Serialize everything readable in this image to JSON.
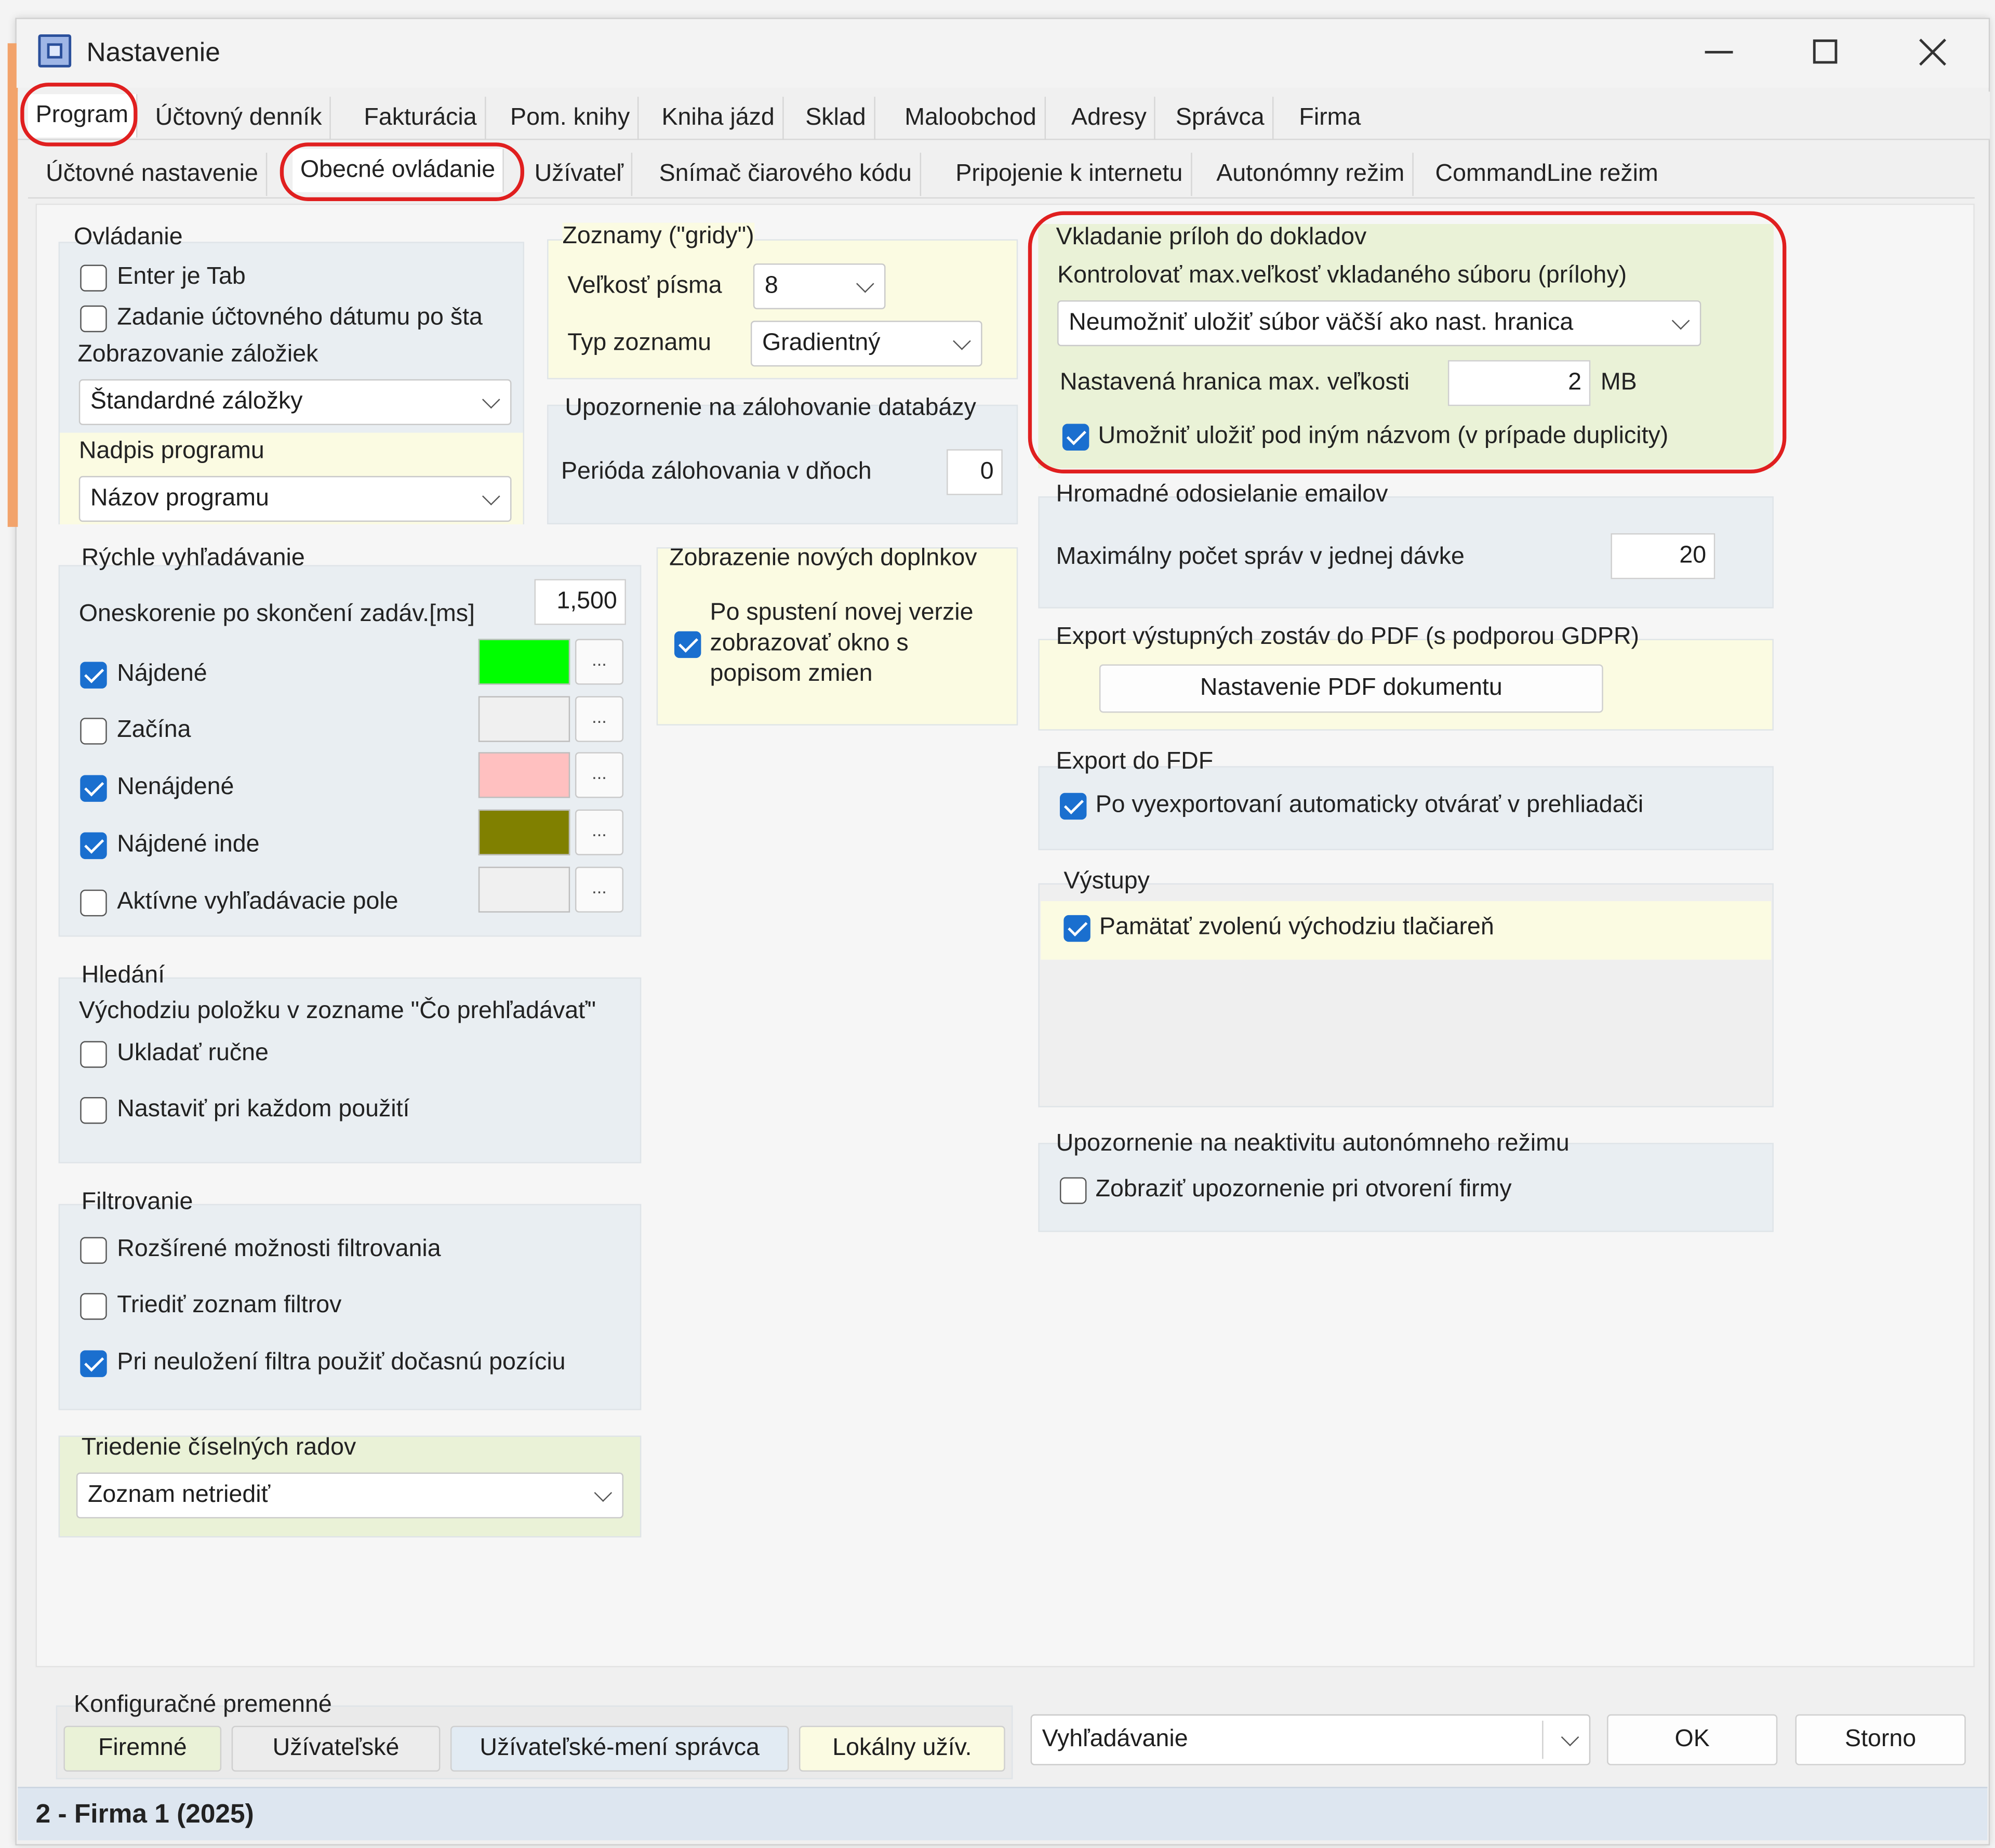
{
  "window": {
    "title": "Nastavenie"
  },
  "main_tabs": [
    "Program",
    "Účtovný denník",
    "Fakturácia",
    "Pom. knihy",
    "Kniha jázd",
    "Sklad",
    "Maloobchod",
    "Adresy",
    "Správca",
    "Firma"
  ],
  "sub_tabs": [
    "Účtovné nastavenie",
    "Obecné ovládanie",
    "Užívateľ",
    "Snímač čiarového kódu",
    "Pripojenie k internetu",
    "Autonómny režim",
    "CommandLine režim"
  ],
  "ovladanie": {
    "title": "Ovládanie",
    "enter_tab": "Enter je Tab",
    "zadanie": "Zadanie účtovného dátumu po šta",
    "zalozky_label": "Zobrazovanie záložiek",
    "zalozky_value": "Štandardné záložky",
    "nadpis_label": "Nadpis programu",
    "nadpis_value": "Názov programu"
  },
  "zoznamy": {
    "title": "Zoznamy (\"gridy\")",
    "font_label": "Veľkosť písma",
    "font_value": "8",
    "typ_label": "Typ zoznamu",
    "typ_value": "Gradientný"
  },
  "zalohovanie": {
    "title": "Upozornenie na zálohovanie databázy",
    "perioda_label": "Perióda zálohovania v dňoch",
    "perioda_value": "0"
  },
  "doplnky": {
    "title": "Zobrazenie nových doplnkov",
    "line1": "Po spustení novej verzie",
    "line2": "zobrazovať okno s",
    "line3": "popisom zmien"
  },
  "vyhladavanie": {
    "title": "Rýchle vyhľadávanie",
    "oneskorenie_label": "Oneskorenie po skončení zadáv.[ms]",
    "oneskorenie_value": "1,500",
    "najdene": "Nájdené",
    "zacina": "Začína",
    "nenajdene": "Nenájdené",
    "najdene_inde": "Nájdené inde",
    "aktivne": "Aktívne vyhľadávacie pole",
    "dots": "...",
    "colors": {
      "najdene": "#00ff00",
      "zacina": "#f0f0f0",
      "nenajdene": "#ffc0c0",
      "najdene_inde": "#808000",
      "aktivne": "#f0f0f0"
    }
  },
  "hladanie": {
    "title": "Hledání",
    "desc": "Východziu položku v zozname \"Čo prehľadávať\"",
    "ukladat": "Ukladať ručne",
    "nastavit": "Nastaviť pri každom použití"
  },
  "filtrovanie": {
    "title": "Filtrovanie",
    "rozsirene": "Rozšírené možnosti filtrovania",
    "triedit": "Triediť zoznam filtrov",
    "dočasna": "Pri neuložení filtra použiť dočasnú pozíciu"
  },
  "triedenie": {
    "title": "Triedenie číselných radov",
    "value": "Zoznam netriediť"
  },
  "prilohy": {
    "title": "Vkladanie príloh do dokladov",
    "kontrola_label": "Kontrolovať max.veľkosť vkladaného súboru (prílohy)",
    "kontrola_value": "Neumožniť uložiť súbor väčší ako nast. hranica",
    "hranica_label": "Nastavená hranica max. veľkosti",
    "hranica_value": "2",
    "hranica_unit": "MB",
    "umoznit": "Umožniť uložiť pod iným názvom (v prípade duplicity)"
  },
  "emaily": {
    "title": "Hromadné odosielanie emailov",
    "max_label": "Maximálny počet správ v jednej dávke",
    "max_value": "20"
  },
  "pdf": {
    "title": "Export výstupných zostáv do PDF (s podporou GDPR)",
    "button": "Nastavenie PDF dokumentu"
  },
  "fdf": {
    "title": "Export do FDF",
    "otvarat": "Po vyexportovaní automaticky otvárať v prehliadači"
  },
  "vystupy": {
    "title": "Výstupy",
    "pamatat": "Pamätať zvolenú východziu tlačiareň"
  },
  "neaktivita": {
    "title": "Upozornenie na neaktivitu autonómneho režimu",
    "zobrazit": "Zobraziť upozornenie pri otvorení firmy"
  },
  "konfig": {
    "title": "Konfiguračné premenné",
    "firemne": "Firemné",
    "uzivatelske": "Užívateľské",
    "uzivatelske_spravca": "Užívateľské-mení správca",
    "lokalny": "Lokálny užív."
  },
  "bottom": {
    "search_value": "Vyhľadávanie",
    "ok": "OK",
    "storno": "Storno"
  },
  "status": {
    "text": "2 - Firma 1 (2025)"
  }
}
